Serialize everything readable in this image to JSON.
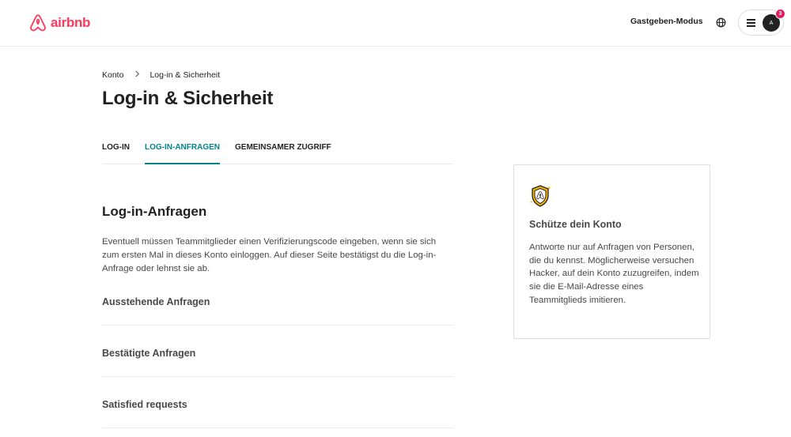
{
  "header": {
    "logo_text": "airbnb",
    "host_mode_label": "Gastgeben-Modus",
    "avatar_initial": "A",
    "notification_count": "3",
    "brand_color": "#FF385C"
  },
  "breadcrumb": {
    "root": "Konto",
    "separator": ">",
    "current": "Log-in & Sicherheit"
  },
  "page_title": "Log-in & Sicherheit",
  "tabs": [
    {
      "label": "LOG-IN",
      "active": false
    },
    {
      "label": "LOG-IN-ANFRAGEN",
      "active": true
    },
    {
      "label": "GEMEINSAMER ZUGRIFF",
      "active": false
    }
  ],
  "section": {
    "title": "Log-in-Anfragen",
    "description": "Eventuell müssen Teammitglieder einen Verifizierungscode eingeben, wenn sie sich zum ersten Mal in dieses Konto einloggen. Auf dieser Seite bestätigst du die Log-in-Anfrage oder lehnst sie ab.",
    "rows": [
      {
        "label": "Ausstehende Anfragen"
      },
      {
        "label": "Bestätigte Anfragen"
      },
      {
        "label": "Satisfied requests"
      }
    ]
  },
  "card": {
    "icon": "shield-icon",
    "title": "Schütze dein Konto",
    "text": "Antworte nur auf Anfragen von Personen, die du kennst. Möglicherweise versuchen Hacker, auf dein Konto zuzugreifen, indem sie die E-Mail-Adresse eines Teammitglieds imitieren."
  },
  "colors": {
    "accent": "#008489",
    "badge": "#E31C5F",
    "shield": "#F5B700"
  }
}
